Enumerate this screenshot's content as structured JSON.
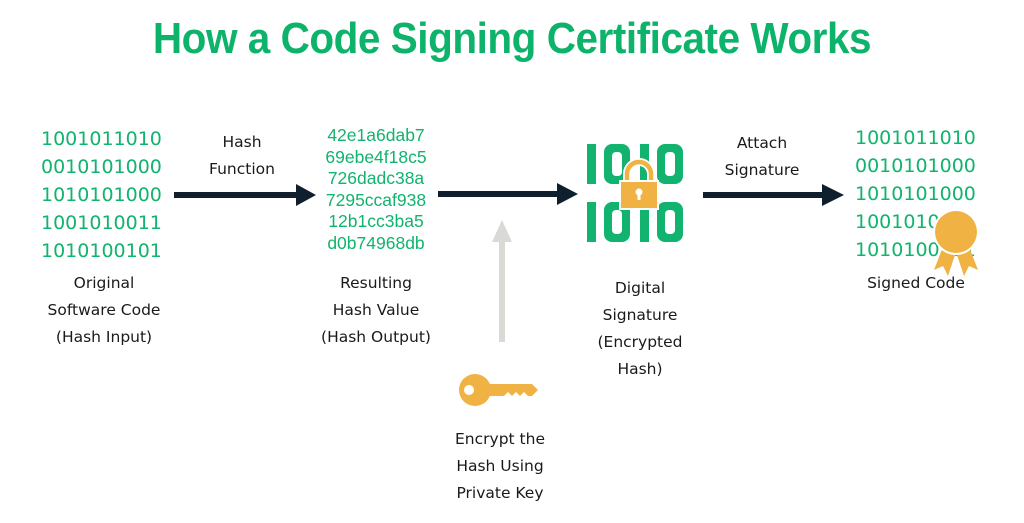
{
  "title": "How a Code Signing Certificate Works",
  "steps": {
    "original_code": {
      "binary_lines": [
        "1001011010",
        "0010101000",
        "1010101000",
        "1001010011",
        "1010100101"
      ],
      "label_lines": [
        "Original",
        "Software Code",
        "(Hash Input)"
      ]
    },
    "hash_function": {
      "label_lines": [
        "Hash",
        "Function"
      ]
    },
    "hash_value": {
      "hash_lines": [
        "42e1a6dab7",
        "69ebe4f18c5",
        "726dadc38a",
        "7295ccaf938",
        "12b1cc3ba5",
        "d0b74968db"
      ],
      "label_lines": [
        "Resulting",
        "Hash Value",
        "(Hash Output)"
      ]
    },
    "private_key": {
      "icon": "key-icon",
      "label_lines": [
        "Encrypt the",
        "Hash Using",
        "Private Key"
      ]
    },
    "digital_signature": {
      "icon_text_lines": [
        "1010",
        "1010"
      ],
      "icon": "padlock-icon",
      "label_lines": [
        "Digital",
        "Signature",
        "(Encrypted",
        "Hash)"
      ]
    },
    "attach_signature": {
      "label_lines": [
        "Attach",
        "Signature"
      ]
    },
    "signed_code": {
      "binary_lines": [
        "1001011010",
        "0010101000",
        "1010101000",
        "1001010011",
        "1010100101"
      ],
      "icon": "certificate-seal-icon",
      "label_lines": [
        "Signed Code"
      ]
    }
  },
  "colors": {
    "accent_green": "#12b36e",
    "arrow_dark": "#0f1f2e",
    "arrow_gray": "#d9d9d6",
    "icon_gold": "#f0b343"
  }
}
